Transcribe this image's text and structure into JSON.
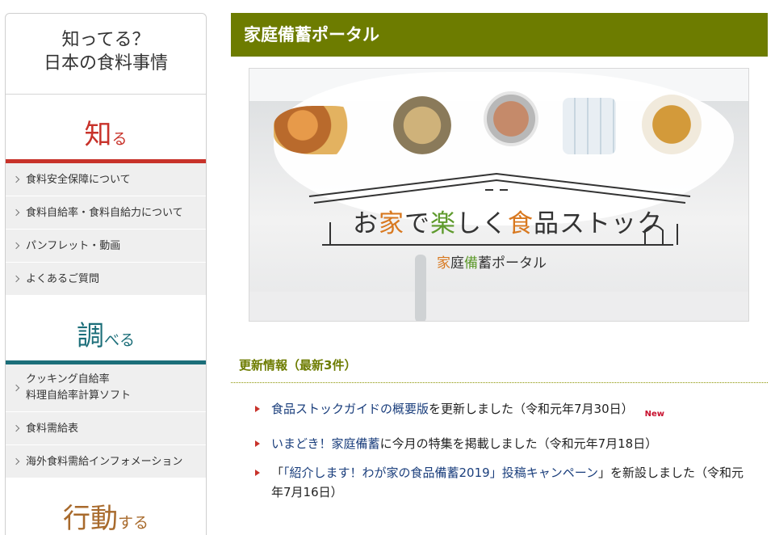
{
  "sidebar": {
    "header": {
      "line1": "知ってる？",
      "line2": "日本の食料事情"
    },
    "sections": [
      {
        "big": "知",
        "small": "る",
        "color": "#c8322a",
        "items": [
          {
            "label": "食料安全保障について"
          },
          {
            "label": "食料自給率・食料自給力について"
          },
          {
            "label": "パンフレット・動画"
          },
          {
            "label": "よくあるご質問"
          }
        ]
      },
      {
        "big": "調",
        "small": "べる",
        "color": "#1b6e79",
        "items": [
          {
            "label_line1": "クッキング自給率",
            "label_line2": "料理自給率計算ソフト"
          },
          {
            "label": "食料需給表"
          },
          {
            "label": "海外食料需給インフォメーション"
          }
        ]
      },
      {
        "big": "行動",
        "small": "する",
        "color": "#a86a2c"
      }
    ]
  },
  "main": {
    "title": "家庭備蓄ポータル",
    "accent_color": "#6d7c00",
    "hero": {
      "title_parts": [
        "お",
        "家",
        "で",
        "楽",
        "しく",
        "食",
        "品ストック"
      ],
      "subtitle_parts": [
        "家",
        "庭",
        "備",
        "蓄ポータル"
      ]
    },
    "news": {
      "heading": "更新情報（最新3件）",
      "items": [
        {
          "link": "食品ストックガイドの概要版",
          "text": "を更新しました（令和元年7月30日）",
          "badge": "New"
        },
        {
          "link": "いまどき！家庭備蓄",
          "text": "に今月の特集を掲載しました（令和元年7月18日）"
        },
        {
          "pre": "「",
          "link": "「紹介します！わが家の食品備蓄2019」投稿キャンペーン",
          "text": "」を新設しました（令和元年7月16日）"
        }
      ]
    }
  }
}
